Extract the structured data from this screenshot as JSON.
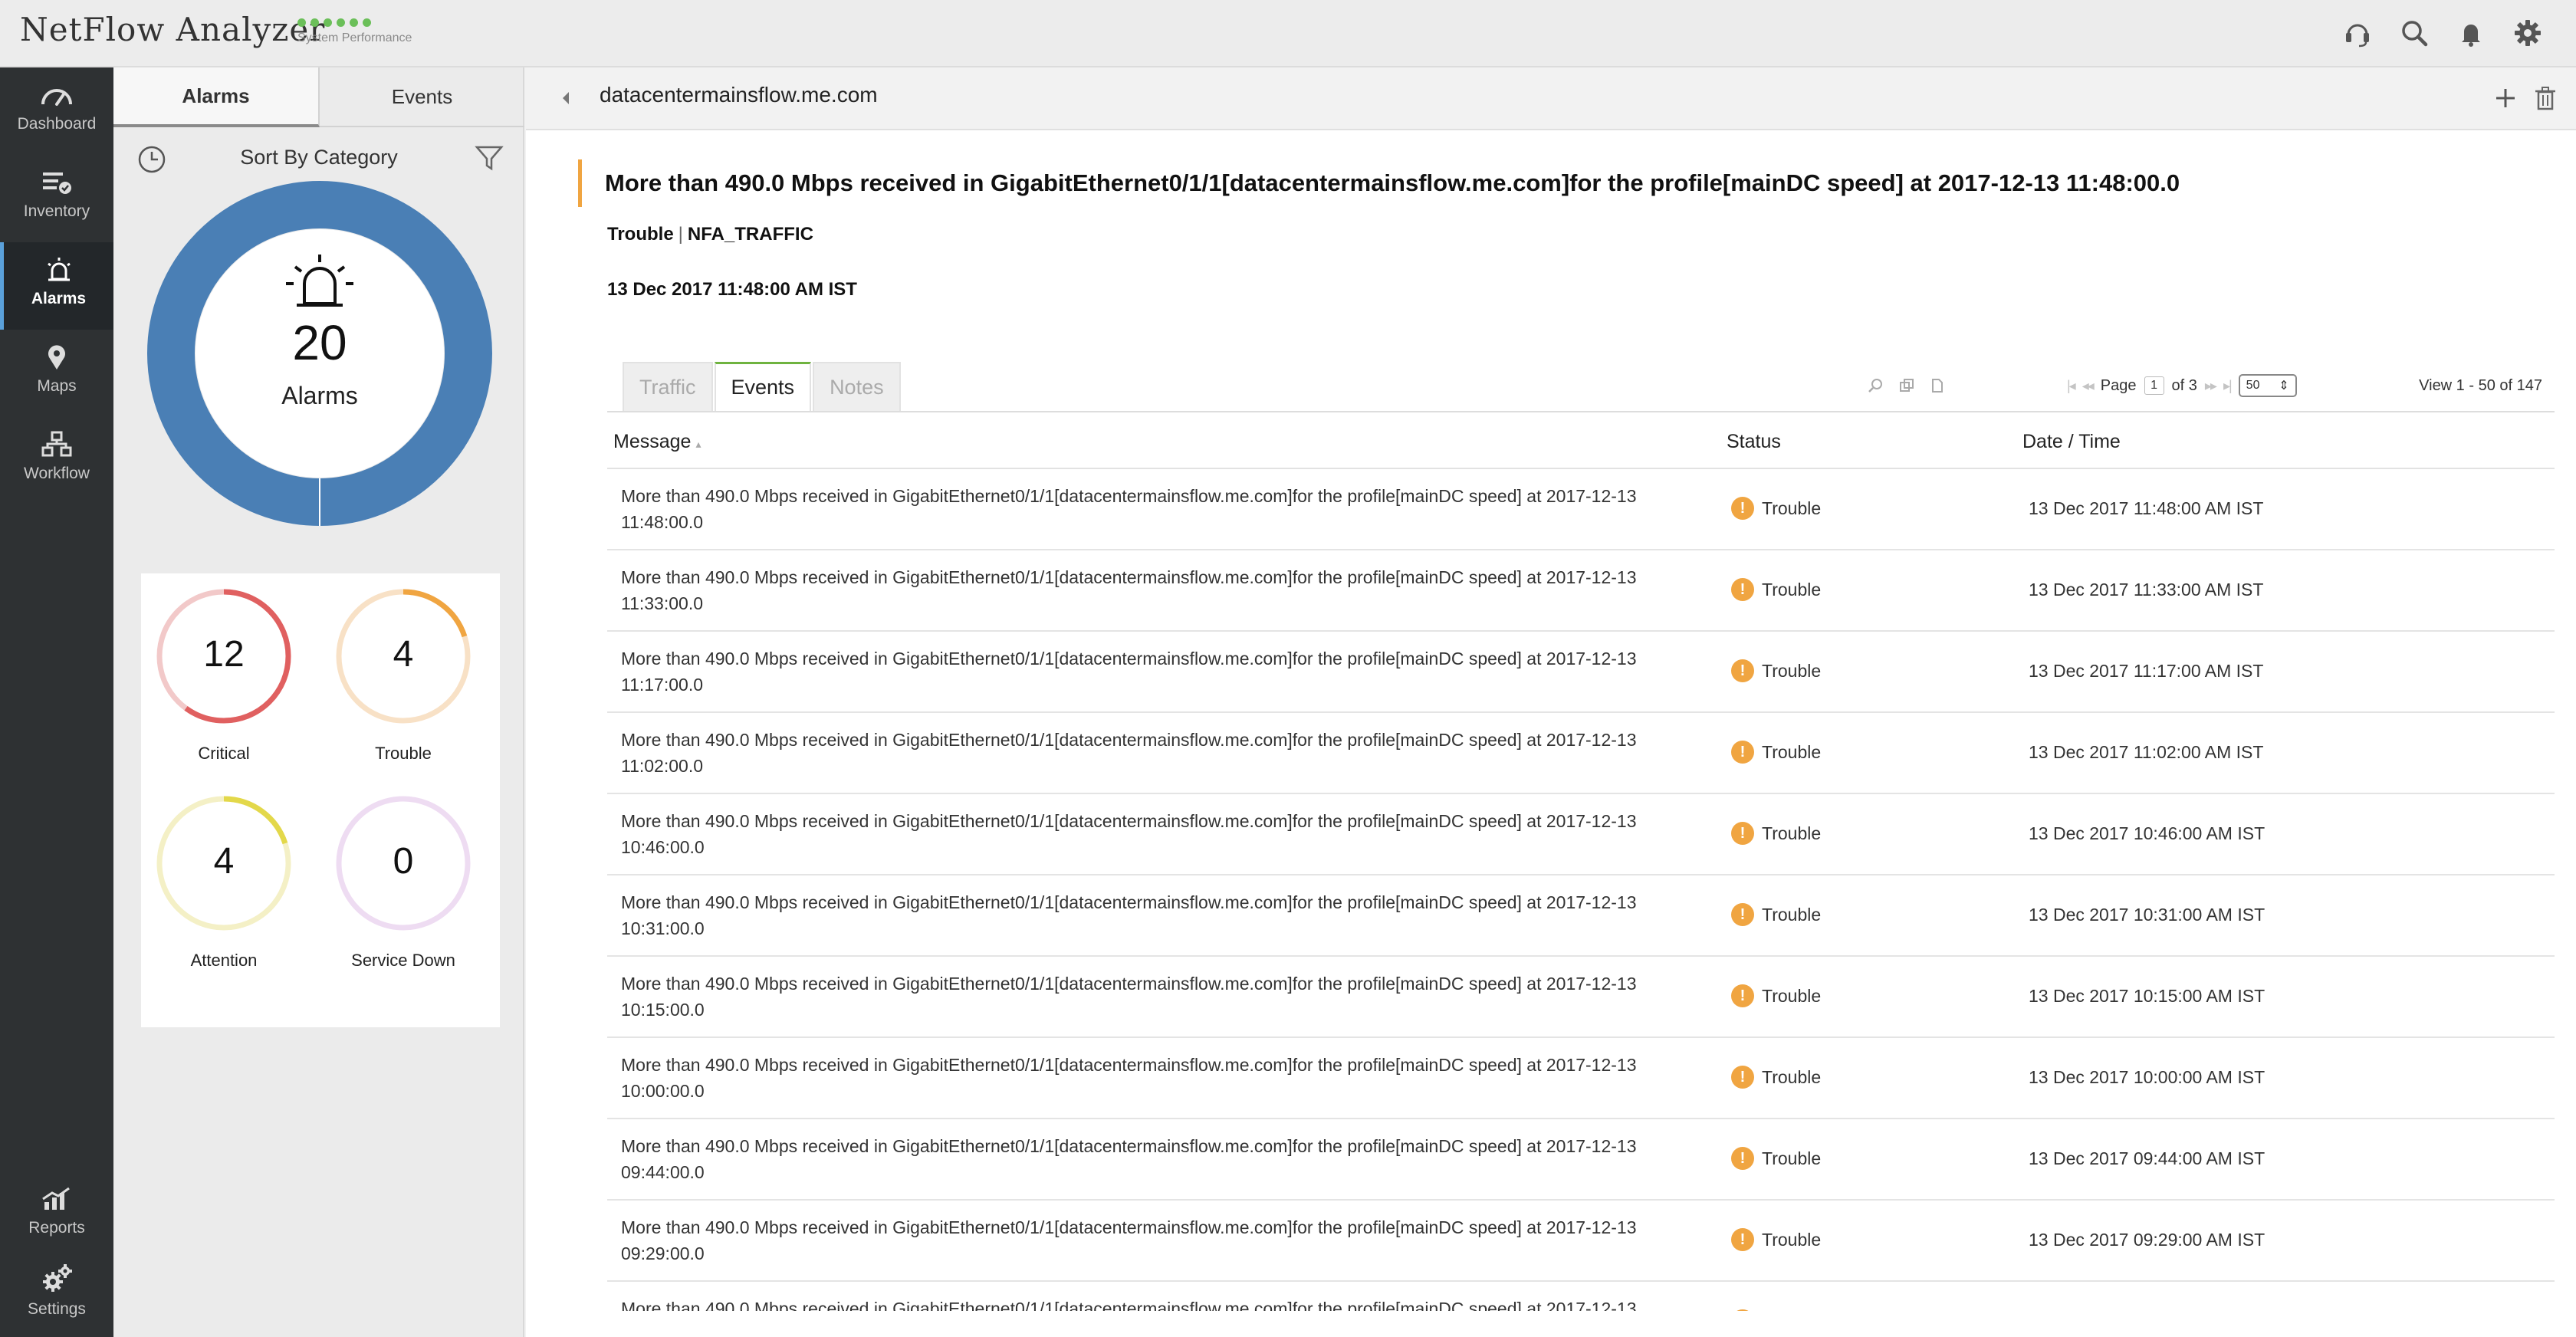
{
  "app": {
    "title": "NetFlow Analyzer",
    "perf_label": "System Performance",
    "perf_dot_color": "#6bbf59"
  },
  "nav": [
    {
      "label": "Dashboard",
      "icon": "dashboard-icon"
    },
    {
      "label": "Inventory",
      "icon": "inventory-icon"
    },
    {
      "label": "Alarms",
      "icon": "alarm-bell-icon",
      "active": true
    },
    {
      "label": "Maps",
      "icon": "map-pin-icon"
    },
    {
      "label": "Workflow",
      "icon": "workflow-icon"
    },
    {
      "label": "Reports",
      "icon": "reports-icon"
    },
    {
      "label": "Settings",
      "icon": "settings-gear-icon"
    }
  ],
  "panel": {
    "tabs": [
      "Alarms",
      "Events"
    ],
    "active_tab": "Alarms",
    "sort_label": "Sort By Category",
    "total": {
      "count": "20",
      "label": "Alarms",
      "color": "#4a7fb5"
    },
    "categories": [
      {
        "count": "12",
        "label": "Critical",
        "fraction": 0.6,
        "color": "#e06060",
        "track": "#f2c9c9"
      },
      {
        "count": "4",
        "label": "Trouble",
        "fraction": 0.2,
        "color": "#f0a541",
        "track": "#f8e1c6"
      },
      {
        "count": "4",
        "label": "Attention",
        "fraction": 0.2,
        "color": "#e3d84a",
        "track": "#f4f0c6"
      },
      {
        "count": "0",
        "label": "Service Down",
        "fraction": 0.0,
        "color": "#c99ad6",
        "track": "#eedcf2"
      }
    ]
  },
  "main": {
    "device": "datacentermainsflow.me.com",
    "alarm_title": "More than 490.0 Mbps received in GigabitEthernet0/1/1[datacentermainsflow.me.com]for the profile[mainDC speed] at 2017-12-13 11:48:00.0",
    "severity": "Trouble",
    "category": "NFA_TRAFFIC",
    "alarm_time": "13 Dec 2017 11:48:00 AM IST",
    "accent_color": "#f0a541",
    "detail_tabs": [
      "Traffic",
      "Events",
      "Notes"
    ],
    "active_detail_tab": "Events",
    "pager": {
      "page_label": "Page",
      "page": "1",
      "of_label": "of 3",
      "page_size": "50",
      "view_range": "View 1 - 50 of 147"
    },
    "columns": [
      "Message",
      "Status",
      "Date / Time"
    ],
    "rows": [
      {
        "message": "More than 490.0 Mbps received in GigabitEthernet0/1/1[datacentermainsflow.me.com]for the profile[mainDC speed] at 2017-12-13 11:48:00.0",
        "status": "Trouble",
        "time": "13 Dec 2017 11:48:00 AM IST"
      },
      {
        "message": "More than 490.0 Mbps received in GigabitEthernet0/1/1[datacentermainsflow.me.com]for the profile[mainDC speed] at 2017-12-13 11:33:00.0",
        "status": "Trouble",
        "time": "13 Dec 2017 11:33:00 AM IST"
      },
      {
        "message": "More than 490.0 Mbps received in GigabitEthernet0/1/1[datacentermainsflow.me.com]for the profile[mainDC speed] at 2017-12-13 11:17:00.0",
        "status": "Trouble",
        "time": "13 Dec 2017 11:17:00 AM IST"
      },
      {
        "message": "More than 490.0 Mbps received in GigabitEthernet0/1/1[datacentermainsflow.me.com]for the profile[mainDC speed] at 2017-12-13 11:02:00.0",
        "status": "Trouble",
        "time": "13 Dec 2017 11:02:00 AM IST"
      },
      {
        "message": "More than 490.0 Mbps received in GigabitEthernet0/1/1[datacentermainsflow.me.com]for the profile[mainDC speed] at 2017-12-13 10:46:00.0",
        "status": "Trouble",
        "time": "13 Dec 2017 10:46:00 AM IST"
      },
      {
        "message": "More than 490.0 Mbps received in GigabitEthernet0/1/1[datacentermainsflow.me.com]for the profile[mainDC speed] at 2017-12-13 10:31:00.0",
        "status": "Trouble",
        "time": "13 Dec 2017 10:31:00 AM IST"
      },
      {
        "message": "More than 490.0 Mbps received in GigabitEthernet0/1/1[datacentermainsflow.me.com]for the profile[mainDC speed] at 2017-12-13 10:15:00.0",
        "status": "Trouble",
        "time": "13 Dec 2017 10:15:00 AM IST"
      },
      {
        "message": "More than 490.0 Mbps received in GigabitEthernet0/1/1[datacentermainsflow.me.com]for the profile[mainDC speed] at 2017-12-13 10:00:00.0",
        "status": "Trouble",
        "time": "13 Dec 2017 10:00:00 AM IST"
      },
      {
        "message": "More than 490.0 Mbps received in GigabitEthernet0/1/1[datacentermainsflow.me.com]for the profile[mainDC speed] at 2017-12-13 09:44:00.0",
        "status": "Trouble",
        "time": "13 Dec 2017 09:44:00 AM IST"
      },
      {
        "message": "More than 490.0 Mbps received in GigabitEthernet0/1/1[datacentermainsflow.me.com]for the profile[mainDC speed] at 2017-12-13 09:29:00.0",
        "status": "Trouble",
        "time": "13 Dec 2017 09:29:00 AM IST"
      },
      {
        "message": "More than 490.0 Mbps received in GigabitEthernet0/1/1[datacentermainsflow.me.com]for the profile[mainDC speed] at 2017-12-13",
        "status": "Trouble",
        "time": ""
      }
    ]
  }
}
